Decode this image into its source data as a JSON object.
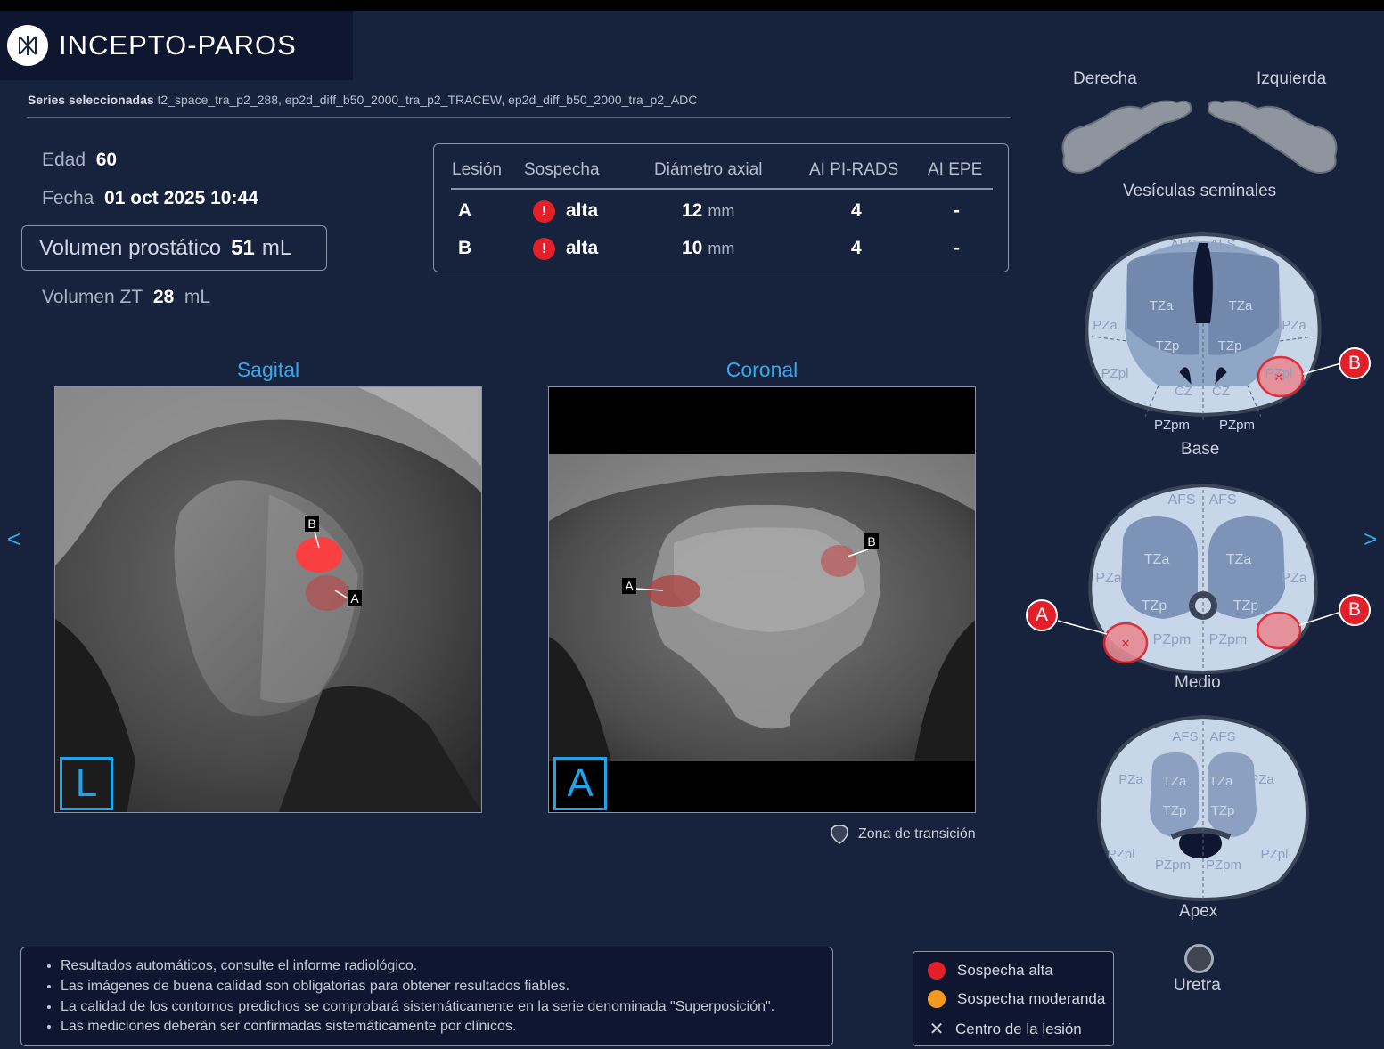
{
  "app": {
    "name": "INCEPTO-PAROS"
  },
  "series": {
    "label": "Series seleccionadas",
    "value": "t2_space_tra_p2_288, ep2d_diff_b50_2000_tra_p2_TRACEW, ep2d_diff_b50_2000_tra_p2_ADC"
  },
  "patient": {
    "age_label": "Edad",
    "age": "60",
    "date_label": "Fecha",
    "date": "01 oct 2025 10:44"
  },
  "volume": {
    "prostate_label": "Volumen prostático",
    "prostate_value": "51",
    "prostate_unit": "mL",
    "zt_label": "Volumen ZT",
    "zt_value": "28",
    "zt_unit": "mL"
  },
  "lesion_table": {
    "headers": [
      "Lesión",
      "Sospecha",
      "Diámetro axial",
      "AI PI-RADS",
      "AI EPE"
    ],
    "rows": [
      {
        "lesion": "A",
        "suspicion": "alta",
        "diameter": "12",
        "unit": "mm",
        "pirads": "4",
        "epe": "-"
      },
      {
        "lesion": "B",
        "suspicion": "alta",
        "diameter": "10",
        "unit": "mm",
        "pirads": "4",
        "epe": "-"
      }
    ],
    "alert_glyph": "!"
  },
  "views": {
    "sagittal": {
      "title": "Sagital",
      "orientation": "L",
      "marker_a": "A",
      "marker_b": "B"
    },
    "coronal": {
      "title": "Coronal",
      "orientation": "A",
      "marker_a": "A",
      "marker_b": "B"
    }
  },
  "nav": {
    "prev": "<",
    "next": ">"
  },
  "transition_zone_legend": "Zona de transición",
  "seminal": {
    "right": "Derecha",
    "left": "Izquierda",
    "title": "Vesículas seminales"
  },
  "zones": {
    "afs": "AFS",
    "tza": "TZa",
    "tzp": "TZp",
    "pza": "PZa",
    "pzpl": "PZpl",
    "pzpm": "PZpm",
    "cz": "CZ"
  },
  "levels": {
    "base": "Base",
    "mid": "Medio",
    "apex": "Apex"
  },
  "lesion_markers": {
    "a": "A",
    "b": "B"
  },
  "urethra": "Uretra",
  "notes": [
    "Resultados automáticos, consulte el informe radiológico.",
    "Las imágenes de buena calidad son obligatorias para obtener resultados fiables.",
    "La calidad de los contornos predichos se comprobará sistemáticamente en la serie denominada \"Superposición\".",
    "Las mediciones deberán ser confirmadas sistemáticamente por clínicos."
  ],
  "legend": {
    "high": "Sospecha alta",
    "moderate": "Sospecha moderanda",
    "center": "Centro de la lesión"
  },
  "colors": {
    "high": "#e1202a",
    "moderate": "#f39a1e",
    "accent": "#35a9ee",
    "background": "#17223d"
  }
}
